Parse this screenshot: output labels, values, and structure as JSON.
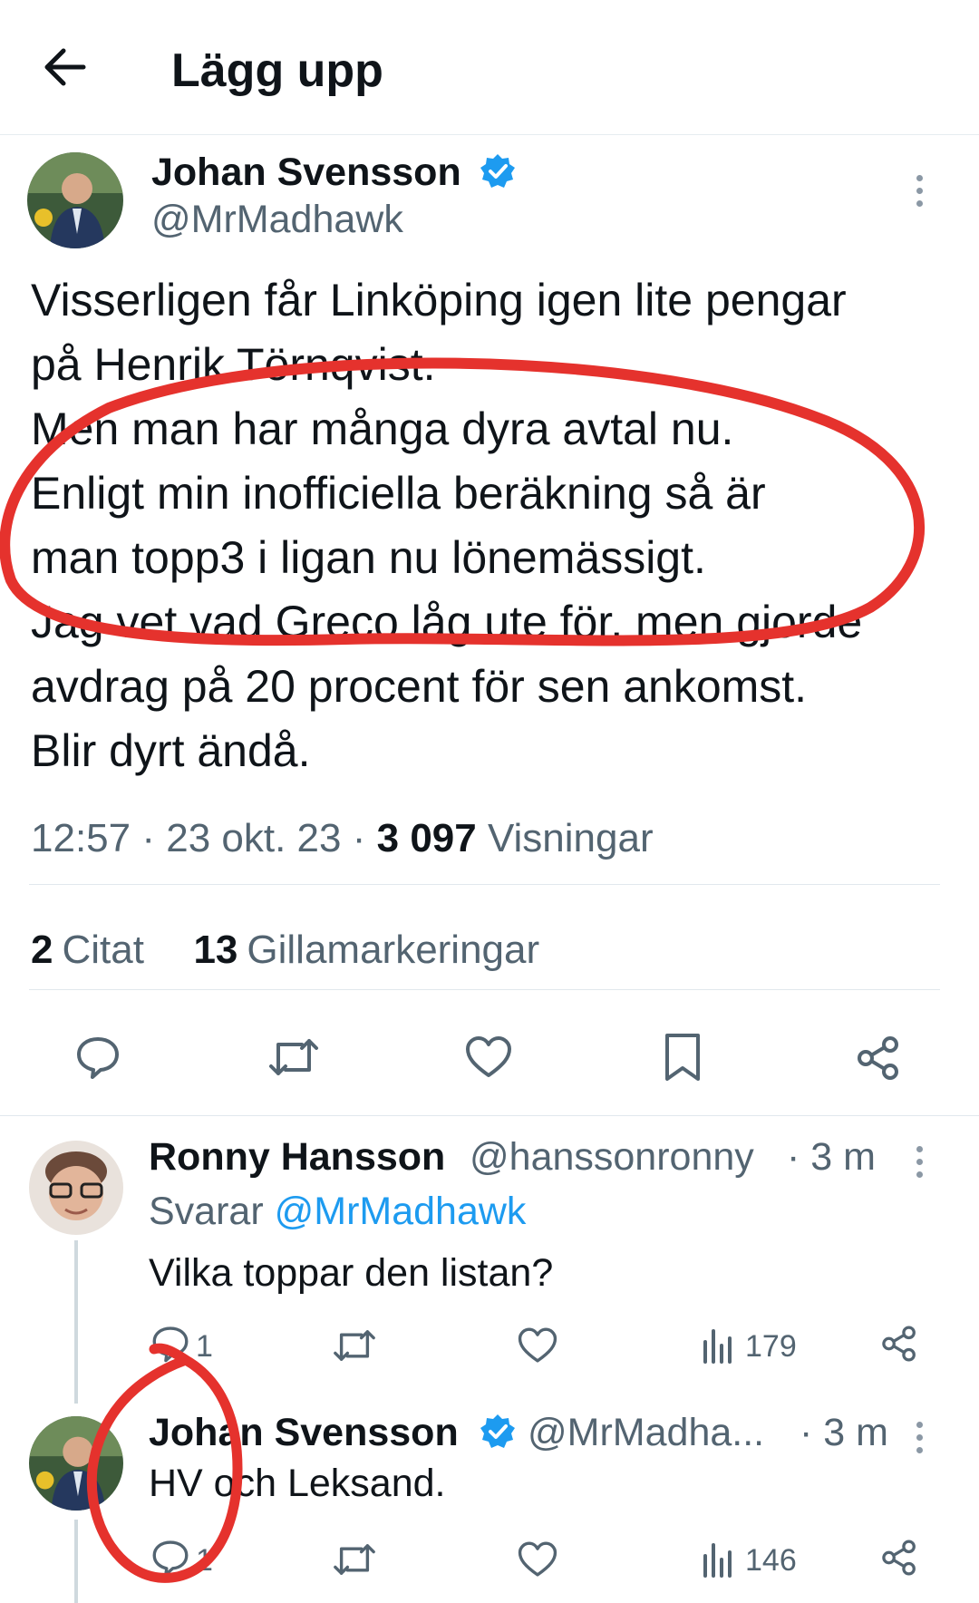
{
  "header": {
    "title": "Lägg upp",
    "back_icon": "arrow-left-icon"
  },
  "post": {
    "author_name": "Johan Svensson",
    "author_handle": "@MrMadhawk",
    "text_lines": [
      "Visserligen får Linköping igen lite pengar",
      "på Henrik Törnqvist.",
      "Men man har många dyra avtal nu.",
      "Enligt min inofficiella beräkning så är",
      "man topp3 i ligan nu lönemässigt.",
      "Jag vet vad Greco låg ute för, men gjorde",
      "avdrag på 20 procent för sen ankomst.",
      "Blir dyrt ändå."
    ],
    "time": "12:57",
    "date": "23 okt. 23",
    "views_count": "3 097",
    "views_label": "Visningar",
    "quotes_count": "2",
    "quotes_label": "Citat",
    "likes_count": "13",
    "likes_label": "Gillamarkeringar"
  },
  "replies": [
    {
      "author_name": "Ronny Hansson",
      "author_handle": "@hanssonronny",
      "age": "· 3 m",
      "replying_to_label": "Svarar",
      "replying_to_handle": "@MrMadhawk",
      "text": "Vilka toppar den listan?",
      "reply_count": "1",
      "views": "179"
    },
    {
      "author_name": "Johan Svensson",
      "author_handle": "@MrMadha...",
      "age": "· 3 m",
      "text": "HV och Leksand.",
      "reply_count": "1",
      "views": "146"
    }
  ],
  "colors": {
    "accent": "#1d9bf0",
    "annotation": "#e5322d",
    "muted": "#536471"
  }
}
